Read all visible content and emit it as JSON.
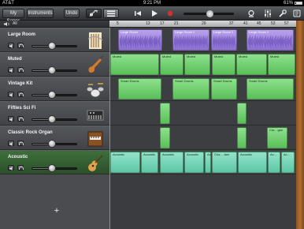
{
  "statusbar": {
    "carrier": "AT&T",
    "time": "9:21 PM",
    "battery": "61%"
  },
  "toolbar": {
    "my_songs": "My Songs",
    "instruments": "Instruments",
    "undo": "Undo"
  },
  "tracks": {
    "all_label": "All",
    "items": [
      {
        "name": "Large Room",
        "icon": "string-ensemble-icon"
      },
      {
        "name": "Muted",
        "icon": "electric-guitar-icon"
      },
      {
        "name": "Vintage Kit",
        "icon": "drum-kit-icon"
      },
      {
        "name": "Fifties Sci Fi",
        "icon": "synth-icon"
      },
      {
        "name": "Classic Rock Organ",
        "icon": "organ-icon"
      },
      {
        "name": "Acoustic",
        "icon": "acoustic-guitar-icon"
      }
    ],
    "add_label": "+"
  },
  "ruler": {
    "bars": [
      "5",
      "13",
      "17",
      "21",
      "29",
      "37",
      "41",
      "45",
      "53",
      "57"
    ]
  },
  "regions": {
    "large_room": [
      "Large Room",
      "Large Room 2",
      "Large Room 2",
      "Large Room 2"
    ],
    "muted": [
      "Muted",
      "Muted",
      "Muted",
      "Muted",
      "Muted",
      "Muted"
    ],
    "vintage": [
      "Smart Drums",
      "Smart Drums",
      "Smart Drums",
      "Smart Drums"
    ],
    "organ": [
      "Cla... gan"
    ],
    "acoustic": [
      "Acoustic",
      "Acoustic",
      "Acoustic",
      "Acoustic",
      "Aco...",
      "Cha... Jam",
      "Acoustic",
      "Ac...",
      "Ac..."
    ]
  },
  "colors": {
    "purple": "#9a7fdc",
    "green": "#6fd06e",
    "selected_track": "#355d33"
  }
}
